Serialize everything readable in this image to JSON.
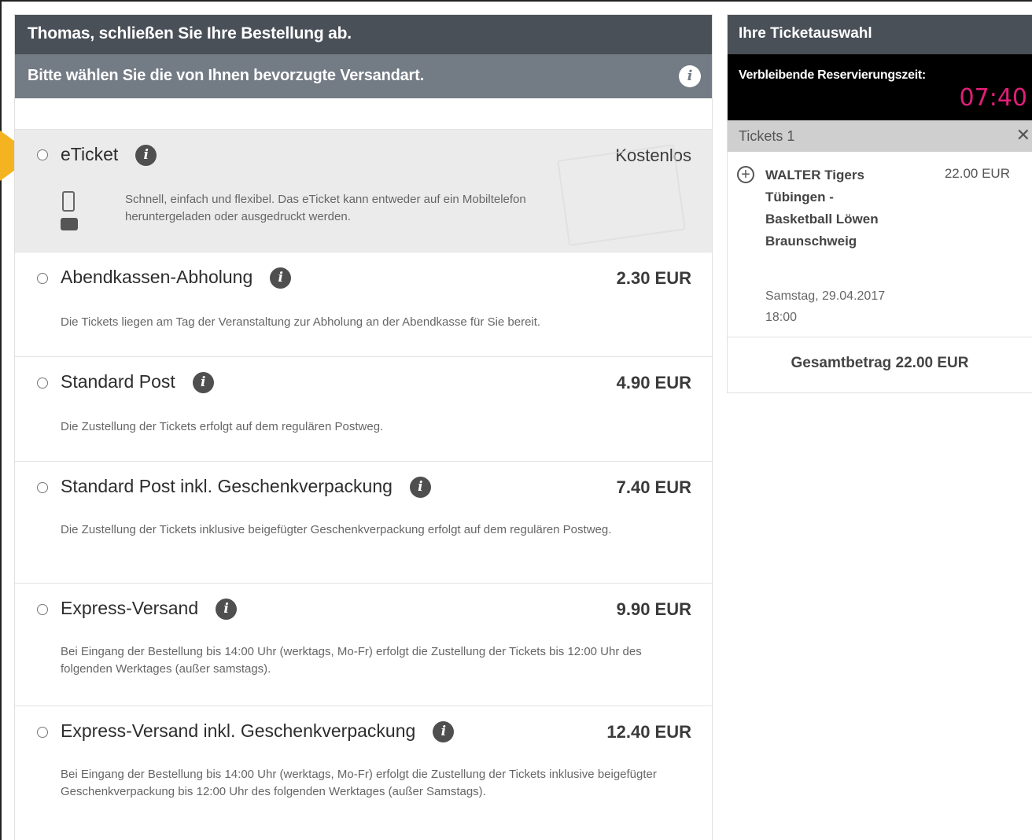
{
  "header": {
    "title": "Thomas, schließen Sie Ihre Bestellung ab.",
    "subtitle": "Bitte wählen Sie die von Ihnen bevorzugte Versandart.",
    "info_glyph": "i"
  },
  "options": [
    {
      "title": "eTicket",
      "price": "Kostenlos",
      "desc": "Schnell, einfach und flexibel. Das eTicket kann entweder auf ein Mobiltelefon heruntergeladen oder ausgedruckt werden.",
      "selected": true
    },
    {
      "title": "Abendkassen-Abholung",
      "price": "2.30 EUR",
      "desc": "Die Tickets liegen am Tag der Veranstaltung zur Abholung an der Abendkasse für Sie bereit."
    },
    {
      "title": "Standard Post",
      "price": "4.90 EUR",
      "desc": "Die Zustellung der Tickets erfolgt auf dem regulären Postweg."
    },
    {
      "title": "Standard Post inkl. Geschenkverpackung",
      "price": "7.40 EUR",
      "desc": "Die Zustellung der Tickets inklusive beigefügter Geschenkverpackung erfolgt auf dem regulären Postweg."
    },
    {
      "title": "Express-Versand",
      "price": "9.90 EUR",
      "desc": "Bei Eingang der Bestellung bis 14:00 Uhr (werktags, Mo-Fr) erfolgt die Zustellung der Tickets bis 12:00 Uhr des folgenden Werktages (außer samstags)."
    },
    {
      "title": "Express-Versand inkl. Geschenkverpackung",
      "price": "12.40 EUR",
      "desc": "Bei Eingang der Bestellung bis 14:00 Uhr (werktags, Mo-Fr) erfolgt die Zustellung der Tickets inklusive beigefügter Geschenkverpackung bis 12:00 Uhr des folgenden Werktages (außer Samstags)."
    }
  ],
  "sidebar": {
    "title": "Ihre Ticketauswahl",
    "timer_label": "Verbleibende Reservierungszeit:",
    "timer_value": "07:40",
    "tickets_label": "Tickets 1",
    "close_glyph": "✕",
    "plus_glyph": "+",
    "item_name": "WALTER Tigers Tübingen - Basketball Löwen Braunschweig",
    "item_price": "22.00 EUR",
    "item_date": "Samstag, 29.04.2017 18:00",
    "total": "Gesamtbetrag 22.00 EUR"
  },
  "colors": {
    "header_dark": "#4a5058",
    "header_sub": "#737b85",
    "timer_accent": "#e21e78",
    "pointer": "#f4b321"
  }
}
